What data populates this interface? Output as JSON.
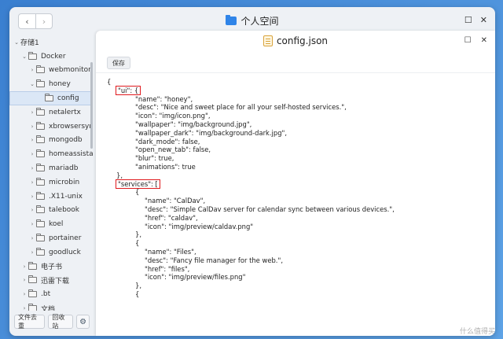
{
  "window": {
    "title": "个人空间",
    "nav_back": "‹",
    "nav_forward": "›",
    "ctrl_max": "☐",
    "ctrl_close": "✕"
  },
  "sidebar": {
    "items": [
      {
        "label": "存储1",
        "caret": "⌄",
        "level": 0,
        "folder": false
      },
      {
        "label": "Docker",
        "caret": "⌄",
        "level": 1,
        "folder": true
      },
      {
        "label": "webmonitor",
        "caret": "›",
        "level": 2,
        "folder": true
      },
      {
        "label": "honey",
        "caret": "⌄",
        "level": 2,
        "folder": true
      },
      {
        "label": "config",
        "caret": "",
        "level": 3,
        "folder": true,
        "selected": true
      },
      {
        "label": "netalertx",
        "caret": "›",
        "level": 2,
        "folder": true
      },
      {
        "label": "xbrowsersync",
        "caret": "›",
        "level": 2,
        "folder": true
      },
      {
        "label": "mongodb",
        "caret": "›",
        "level": 2,
        "folder": true
      },
      {
        "label": "homeassistar",
        "caret": "›",
        "level": 2,
        "folder": true
      },
      {
        "label": "mariadb",
        "caret": "›",
        "level": 2,
        "folder": true
      },
      {
        "label": "microbin",
        "caret": "›",
        "level": 2,
        "folder": true
      },
      {
        "label": ".X11-unix",
        "caret": "›",
        "level": 2,
        "folder": true
      },
      {
        "label": "talebook",
        "caret": "›",
        "level": 2,
        "folder": true
      },
      {
        "label": "koel",
        "caret": "›",
        "level": 2,
        "folder": true
      },
      {
        "label": "portainer",
        "caret": "›",
        "level": 2,
        "folder": true
      },
      {
        "label": "goodluck",
        "caret": "›",
        "level": 2,
        "folder": true
      },
      {
        "label": "电子书",
        "caret": "›",
        "level": 1,
        "folder": true
      },
      {
        "label": "迅雷下载",
        "caret": "›",
        "level": 1,
        "folder": true
      },
      {
        "label": ".bt",
        "caret": "›",
        "level": 1,
        "folder": true
      },
      {
        "label": "文档",
        "caret": "›",
        "level": 1,
        "folder": true
      }
    ],
    "footer": {
      "dedupe_label": "文件去重",
      "recycle_label": "回收站",
      "gear_glyph": "⚙"
    }
  },
  "editor": {
    "file_name": "config.json",
    "ctrl_max": "☐",
    "ctrl_close": "✕",
    "save_label": "保存",
    "lines": [
      {
        "indent": 0,
        "text": "{"
      },
      {
        "indent": 1,
        "text": "\"ui\": {",
        "highlight": true
      },
      {
        "indent": 3,
        "text": "\"name\": \"honey\","
      },
      {
        "indent": 3,
        "text": "\"desc\": \"Nice and sweet place for all your self-hosted services.\","
      },
      {
        "indent": 3,
        "text": "\"icon\": \"img/icon.png\","
      },
      {
        "indent": 3,
        "text": "\"wallpaper\": \"img/background.jpg\","
      },
      {
        "indent": 3,
        "text": "\"wallpaper_dark\": \"img/background-dark.jpg\","
      },
      {
        "indent": 3,
        "text": "\"dark_mode\": false,"
      },
      {
        "indent": 3,
        "text": "\"open_new_tab\": false,"
      },
      {
        "indent": 3,
        "text": "\"blur\": true,"
      },
      {
        "indent": 3,
        "text": "\"animations\": true"
      },
      {
        "indent": 1,
        "text": "},"
      },
      {
        "indent": 1,
        "text": "\"services\": [",
        "highlight": true
      },
      {
        "indent": 3,
        "text": "{"
      },
      {
        "indent": 4,
        "text": "\"name\": \"CalDav\","
      },
      {
        "indent": 4,
        "text": "\"desc\": \"Simple CalDav server for calendar sync between various devices.\","
      },
      {
        "indent": 4,
        "text": "\"href\": \"caldav\","
      },
      {
        "indent": 4,
        "text": "\"icon\": \"img/preview/caldav.png\""
      },
      {
        "indent": 3,
        "text": "},"
      },
      {
        "indent": 3,
        "text": "{"
      },
      {
        "indent": 4,
        "text": "\"name\": \"Files\","
      },
      {
        "indent": 4,
        "text": "\"desc\": \"Fancy file manager for the web.\","
      },
      {
        "indent": 4,
        "text": "\"href\": \"files\","
      },
      {
        "indent": 4,
        "text": "\"icon\": \"img/preview/files.png\""
      },
      {
        "indent": 3,
        "text": "},"
      },
      {
        "indent": 3,
        "text": "{"
      }
    ]
  },
  "watermark": "什么值得买"
}
